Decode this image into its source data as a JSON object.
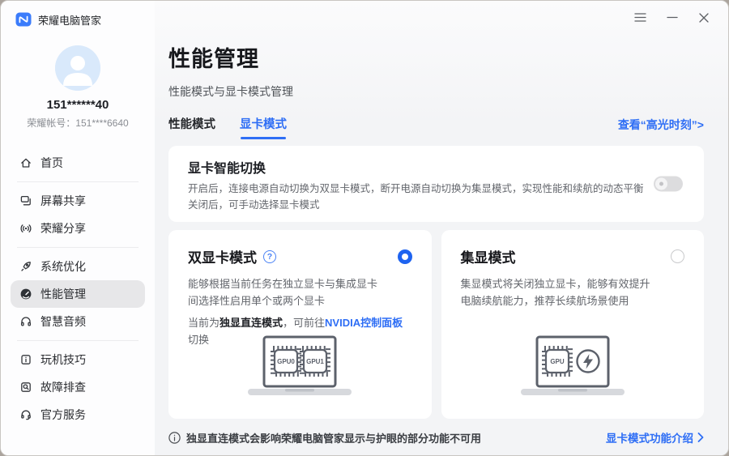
{
  "window": {
    "app_title": "荣耀电脑管家"
  },
  "colors": {
    "accent": "#2e6ef5",
    "radio_selected": "#1e63f0",
    "toggle_off": "#dcdcde"
  },
  "sidebar": {
    "user": {
      "name": "151******40",
      "account": "荣耀帐号：151****6640"
    },
    "items": [
      {
        "label": "首页"
      },
      {
        "label": "屏幕共享"
      },
      {
        "label": "荣耀分享"
      },
      {
        "label": "系统优化"
      },
      {
        "label": "性能管理"
      },
      {
        "label": "智慧音频"
      },
      {
        "label": "玩机技巧"
      },
      {
        "label": "故障排查"
      },
      {
        "label": "官方服务"
      }
    ]
  },
  "main": {
    "title": "性能管理",
    "subtitle": "性能模式与显卡模式管理",
    "tabs": [
      {
        "label": "性能模式"
      },
      {
        "label": "显卡模式"
      }
    ],
    "highlight_link": "查看“高光时刻”>"
  },
  "smart_switch": {
    "title": "显卡智能切换",
    "desc_line1": "开启后，连接电源自动切换为双显卡模式，断开电源自动切换为集显模式，实现性能和续航的动态平衡",
    "desc_line2": "关闭后，可手动选择显卡模式",
    "state": "off"
  },
  "cards": {
    "dual": {
      "title": "双显卡模式",
      "help": "?",
      "desc_line1": "能够根据当前任务在独立显卡与集成显卡",
      "desc_line2": "间选择性启用单个或两个显卡",
      "cur_prefix": "当前为",
      "cur_mode": "独显直连模式",
      "cur_mid": "，可前往",
      "cur_link": "NVIDIA控制面板",
      "cur_suffix": "切换",
      "selected": true,
      "gpu0": "GPU0",
      "gpu1": "GPU1"
    },
    "igpu": {
      "title": "集显模式",
      "desc_line1": "集显模式将关闭独立显卡，能够有效提升",
      "desc_line2": "电脑续航能力，推荐长续航场景使用",
      "selected": false,
      "gpu": "GPU"
    }
  },
  "footer": {
    "info": "独显直连模式会影响荣耀电脑管家显示与护眼的部分功能不可用",
    "link": "显卡模式功能介绍"
  }
}
